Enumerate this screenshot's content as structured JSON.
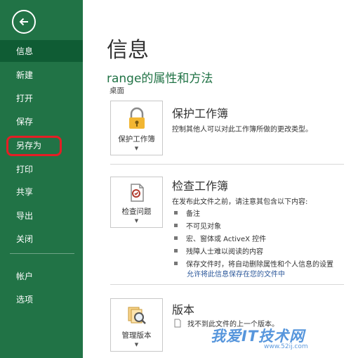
{
  "nav": {
    "items": [
      {
        "label": "信息"
      },
      {
        "label": "新建"
      },
      {
        "label": "打开"
      },
      {
        "label": "保存"
      },
      {
        "label": "另存为"
      },
      {
        "label": "打印"
      },
      {
        "label": "共享"
      },
      {
        "label": "导出"
      },
      {
        "label": "关闭"
      },
      {
        "label": "帐户"
      },
      {
        "label": "选项"
      }
    ],
    "active": "信息",
    "highlighted": "另存为"
  },
  "main": {
    "title": "信息",
    "file_title": "range的属性和方法",
    "file_location": "桌面",
    "protect": {
      "tile_label": "保护工作簿",
      "heading": "保护工作簿",
      "description": "控制其他人可以对此工作簿所做的更改类型。"
    },
    "inspect": {
      "tile_label": "检查问题",
      "heading": "检查工作簿",
      "description": "在发布此文件之前，请注意其包含以下内容:",
      "bullets": [
        "备注",
        "不可见对象",
        "宏、窗体或 ActiveX 控件",
        "残障人士难以阅读的内容",
        "保存文件时，将自动删除属性和个人信息的设置"
      ],
      "link": "允许将此信息保存在您的文件中"
    },
    "versions": {
      "tile_label": "管理版本",
      "heading": "版本",
      "description": "找不到此文件的上一个版本。"
    }
  },
  "watermark": {
    "text": "我爱IT技术网",
    "url": "www.52ij.com"
  },
  "colors": {
    "sidebar": "#217346",
    "active_item": "#0f5c34",
    "highlight": "#e41e25",
    "link": "#2b579a"
  }
}
